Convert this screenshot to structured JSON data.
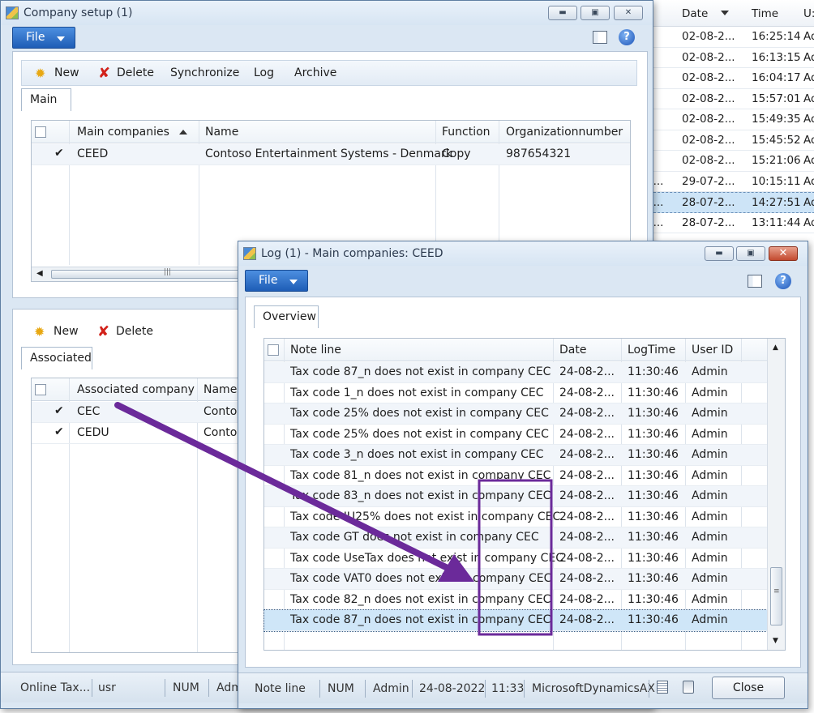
{
  "background_list": {
    "headers": {
      "date": "Date",
      "time": "Time",
      "user": "U:"
    },
    "rows": [
      {
        "date": "02-08-2...",
        "time": "16:25:14",
        "user": "Ad"
      },
      {
        "date": "02-08-2...",
        "time": "16:13:15",
        "user": "Ad"
      },
      {
        "date": "02-08-2...",
        "time": "16:04:17",
        "user": "Ad"
      },
      {
        "date": "02-08-2...",
        "time": "15:57:01",
        "user": "Ad"
      },
      {
        "date": "02-08-2...",
        "time": "15:49:35",
        "user": "Ad"
      },
      {
        "date": "02-08-2...",
        "time": "15:45:52",
        "user": "Ad"
      },
      {
        "date": "02-08-2...",
        "time": "15:21:06",
        "user": "Ad"
      },
      {
        "prefix": "2...",
        "date": "29-07-2...",
        "time": "10:15:11",
        "user": "Ad"
      },
      {
        "prefix": "2...",
        "date": "28-07-2...",
        "time": "14:27:51",
        "user": "Ad",
        "selected": true
      },
      {
        "prefix": "2...",
        "date": "28-07-2...",
        "time": "13:11:44",
        "user": "Ad"
      }
    ]
  },
  "company_setup": {
    "title": "Company setup (1)",
    "file_label": "File",
    "toolbar": {
      "new": "New",
      "delete": "Delete",
      "synchronize": "Synchronize",
      "log": "Log",
      "archive": "Archive"
    },
    "main_tab": "Main",
    "main_grid": {
      "headers": {
        "main_companies": "Main companies",
        "name": "Name",
        "function": "Function",
        "org": "Organizationnumber"
      },
      "rows": [
        {
          "main_companies": "CEED",
          "name": "Contoso Entertainment Systems - Denmark",
          "function": "Copy",
          "org": "987654321"
        }
      ]
    },
    "assoc_toolbar": {
      "new": "New",
      "delete": "Delete"
    },
    "assoc_tab": "Associated",
    "assoc_grid": {
      "headers": {
        "company": "Associated company",
        "name": "Name"
      },
      "rows": [
        {
          "company": "CEC",
          "name": "Contos"
        },
        {
          "company": "CEDU",
          "name": "Contos"
        }
      ]
    },
    "status": {
      "item1": "Online Tax...",
      "item2": "usr",
      "item3": "NUM",
      "item4": "Adm"
    }
  },
  "log_window": {
    "title": "Log (1) - Main companies: CEED",
    "file_label": "File",
    "tab": "Overview",
    "headers": {
      "note": "Note line",
      "date": "Date",
      "time": "LogTime",
      "user": "User ID"
    },
    "rows": [
      {
        "note": "Tax code 87_n does not exist in company CEC",
        "date": "24-08-2...",
        "time": "11:30:46",
        "user": "Admin"
      },
      {
        "note": "Tax code 1_n does not exist in company CEC",
        "date": "24-08-2...",
        "time": "11:30:46",
        "user": "Admin"
      },
      {
        "note": "Tax code 25% does not exist in company CEC",
        "date": "24-08-2...",
        "time": "11:30:46",
        "user": "Admin"
      },
      {
        "note": "Tax code 25% does not exist in company CEC",
        "date": "24-08-2...",
        "time": "11:30:46",
        "user": "Admin"
      },
      {
        "note": "Tax code 3_n does not exist in company CEC",
        "date": "24-08-2...",
        "time": "11:30:46",
        "user": "Admin"
      },
      {
        "note": "Tax code 81_n does not exist in company CEC",
        "date": "24-08-2...",
        "time": "11:30:46",
        "user": "Admin"
      },
      {
        "note": "Tax code 83_n does not exist in company CEC",
        "date": "24-08-2...",
        "time": "11:30:46",
        "user": "Admin"
      },
      {
        "note": "Tax code IU25% does not exist in company CEC",
        "date": "24-08-2...",
        "time": "11:30:46",
        "user": "Admin"
      },
      {
        "note": "Tax code GT does not exist in company CEC",
        "date": "24-08-2...",
        "time": "11:30:46",
        "user": "Admin"
      },
      {
        "note": "Tax code UseTax does not exist in company CEC",
        "date": "24-08-2...",
        "time": "11:30:46",
        "user": "Admin"
      },
      {
        "note": "Tax code VAT0 does not exist in company CEC",
        "date": "24-08-2...",
        "time": "11:30:46",
        "user": "Admin"
      },
      {
        "note": "Tax code 82_n does not exist in company CEC",
        "date": "24-08-2...",
        "time": "11:30:46",
        "user": "Admin"
      },
      {
        "note": "Tax code 87_n does not exist in company CEC",
        "date": "24-08-2...",
        "time": "11:30:46",
        "user": "Admin",
        "selected": true
      }
    ],
    "status": {
      "note": "Note line",
      "num": "NUM",
      "user": "Admin",
      "date": "24-08-2022",
      "time": "11:33",
      "app": "MicrosoftDynamicsAX"
    },
    "close_label": "Close"
  },
  "annotation": {
    "arrow_color": "#6b2a9a",
    "box_color": "#6b2a9a"
  }
}
